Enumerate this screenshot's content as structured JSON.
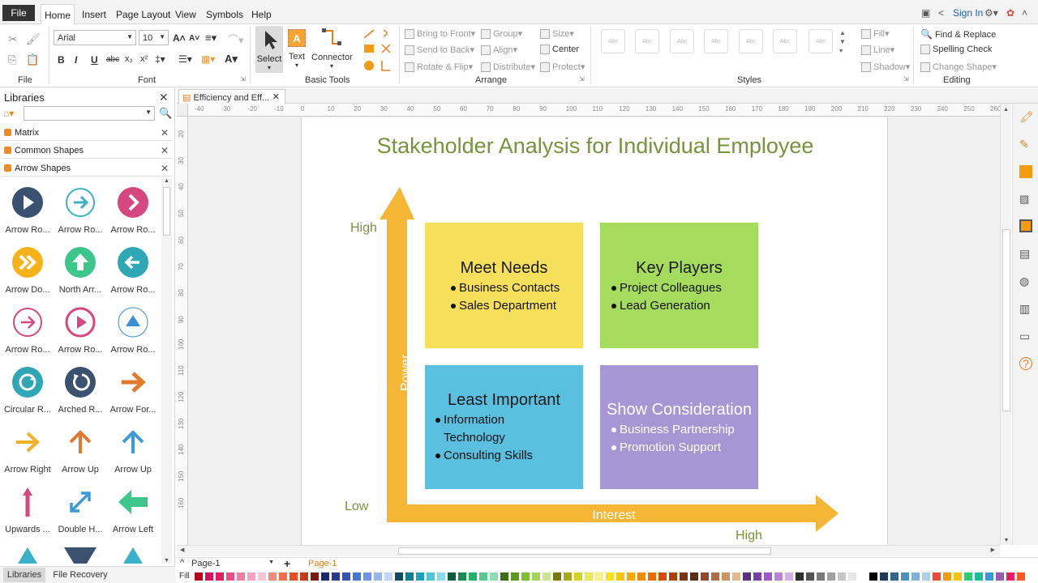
{
  "menu": {
    "file": "File",
    "tabs": [
      "Home",
      "Insert",
      "Page Layout",
      "View",
      "Symbols",
      "Help"
    ],
    "sign_in": "Sign In"
  },
  "ribbon": {
    "font_name": "Arial",
    "font_size": "10",
    "groups": {
      "file": "File",
      "font": "Font",
      "basic_tools": "Basic Tools",
      "arrange": "Arrange",
      "styles": "Styles",
      "editing": "Editing"
    },
    "basic_tools": {
      "select": "Select",
      "text": "Text",
      "connector": "Connector"
    },
    "arrange": {
      "bring_to_front": "Bring to Front",
      "send_to_back": "Send to Back",
      "rotate_flip": "Rotate & Flip",
      "group": "Group",
      "align": "Align",
      "distribute": "Distribute",
      "size": "Size",
      "center": "Center",
      "protect": "Protect"
    },
    "style_sample": "Abc",
    "fill": "Fill",
    "line": "Line",
    "shadow": "Shadow",
    "editing": {
      "find_replace": "Find & Replace",
      "spelling": "Spelling Check",
      "change_shape": "Change Shape"
    }
  },
  "libraries": {
    "title": "Libraries",
    "sections": [
      "Matrix",
      "Common Shapes",
      "Arrow Shapes"
    ],
    "shapes": [
      {
        "label": "Arrow Ro...",
        "color": "#3a5170",
        "kind": "play"
      },
      {
        "label": "Arrow Ro...",
        "color": "#3bb0c9",
        "kind": "ring-right"
      },
      {
        "label": "Arrow Ro...",
        "color": "#d6477f",
        "kind": "chev"
      },
      {
        "label": "Arrow Do...",
        "color": "#f7b21a",
        "kind": "double"
      },
      {
        "label": "North Arr...",
        "color": "#3cc68a",
        "kind": "up"
      },
      {
        "label": "Arrow Ro...",
        "color": "#2fa7b5",
        "kind": "left"
      },
      {
        "label": "Arrow Ro...",
        "color": "#d6477f",
        "kind": "ring-right2"
      },
      {
        "label": "Arrow Ro...",
        "color": "#d6477f",
        "kind": "ring-play"
      },
      {
        "label": "Arrow Ro...",
        "color": "#3c8fd6",
        "kind": "tri"
      },
      {
        "label": "Circular R...",
        "color": "#2fa7b5",
        "kind": "circ"
      },
      {
        "label": "Arched R...",
        "color": "#3a5170",
        "kind": "arch"
      },
      {
        "label": "Arrow For...",
        "color": "#e3782e",
        "kind": "fwd"
      },
      {
        "label": "Arrow Right",
        "color": "#f2b02a",
        "kind": "right"
      },
      {
        "label": "Arrow Up",
        "color": "#e3782e",
        "kind": "upthin"
      },
      {
        "label": "Arrow Up",
        "color": "#3c9ad6",
        "kind": "upthin"
      },
      {
        "label": "Upwards ...",
        "color": "#d6477f",
        "kind": "upline"
      },
      {
        "label": "Double H...",
        "color": "#3c9ad6",
        "kind": "diag"
      },
      {
        "label": "Arrow Left",
        "color": "#3cc68a",
        "kind": "bigleft"
      }
    ]
  },
  "doc_tab": "Efficiency and Eff...",
  "ruler_h": [
    "-40",
    "-30",
    "-20",
    "-10",
    "0",
    "10",
    "20",
    "30",
    "40",
    "50",
    "60",
    "70",
    "80",
    "90",
    "100",
    "110",
    "120",
    "130",
    "140",
    "150",
    "160",
    "170",
    "180",
    "190",
    "200",
    "210",
    "220",
    "230",
    "240",
    "250",
    "260"
  ],
  "ruler_v": [
    "20",
    "30",
    "40",
    "50",
    "60",
    "70",
    "80",
    "90",
    "100",
    "110",
    "120",
    "130",
    "140",
    "150",
    "160"
  ],
  "diagram": {
    "title": "Stakeholder Analysis for Individual Employee",
    "y_axis": "Power",
    "x_axis": "Interest",
    "high_left": "High",
    "low": "Low",
    "high_bottom": "High",
    "quadrants": [
      {
        "title": "Meet Needs",
        "items": [
          "Business Contacts",
          "Sales Department"
        ],
        "color": "#f6df5a"
      },
      {
        "title": "Key Players",
        "items": [
          "Project Colleagues",
          "Lead Generation"
        ],
        "color": "#a6dc5e"
      },
      {
        "title": "Least Important",
        "items": [
          "Information Technology",
          "Consulting Skills"
        ],
        "color": "#5bbfe0"
      },
      {
        "title": "Show Consideration",
        "items": [
          "Business Partnership",
          "Promotion Support"
        ],
        "color": "#a696d4"
      }
    ]
  },
  "pages": {
    "current": "Page-1",
    "tab": "Page-1"
  },
  "fill_label": "Fill",
  "bottom_tabs": [
    "Libraries",
    "File Recovery"
  ]
}
